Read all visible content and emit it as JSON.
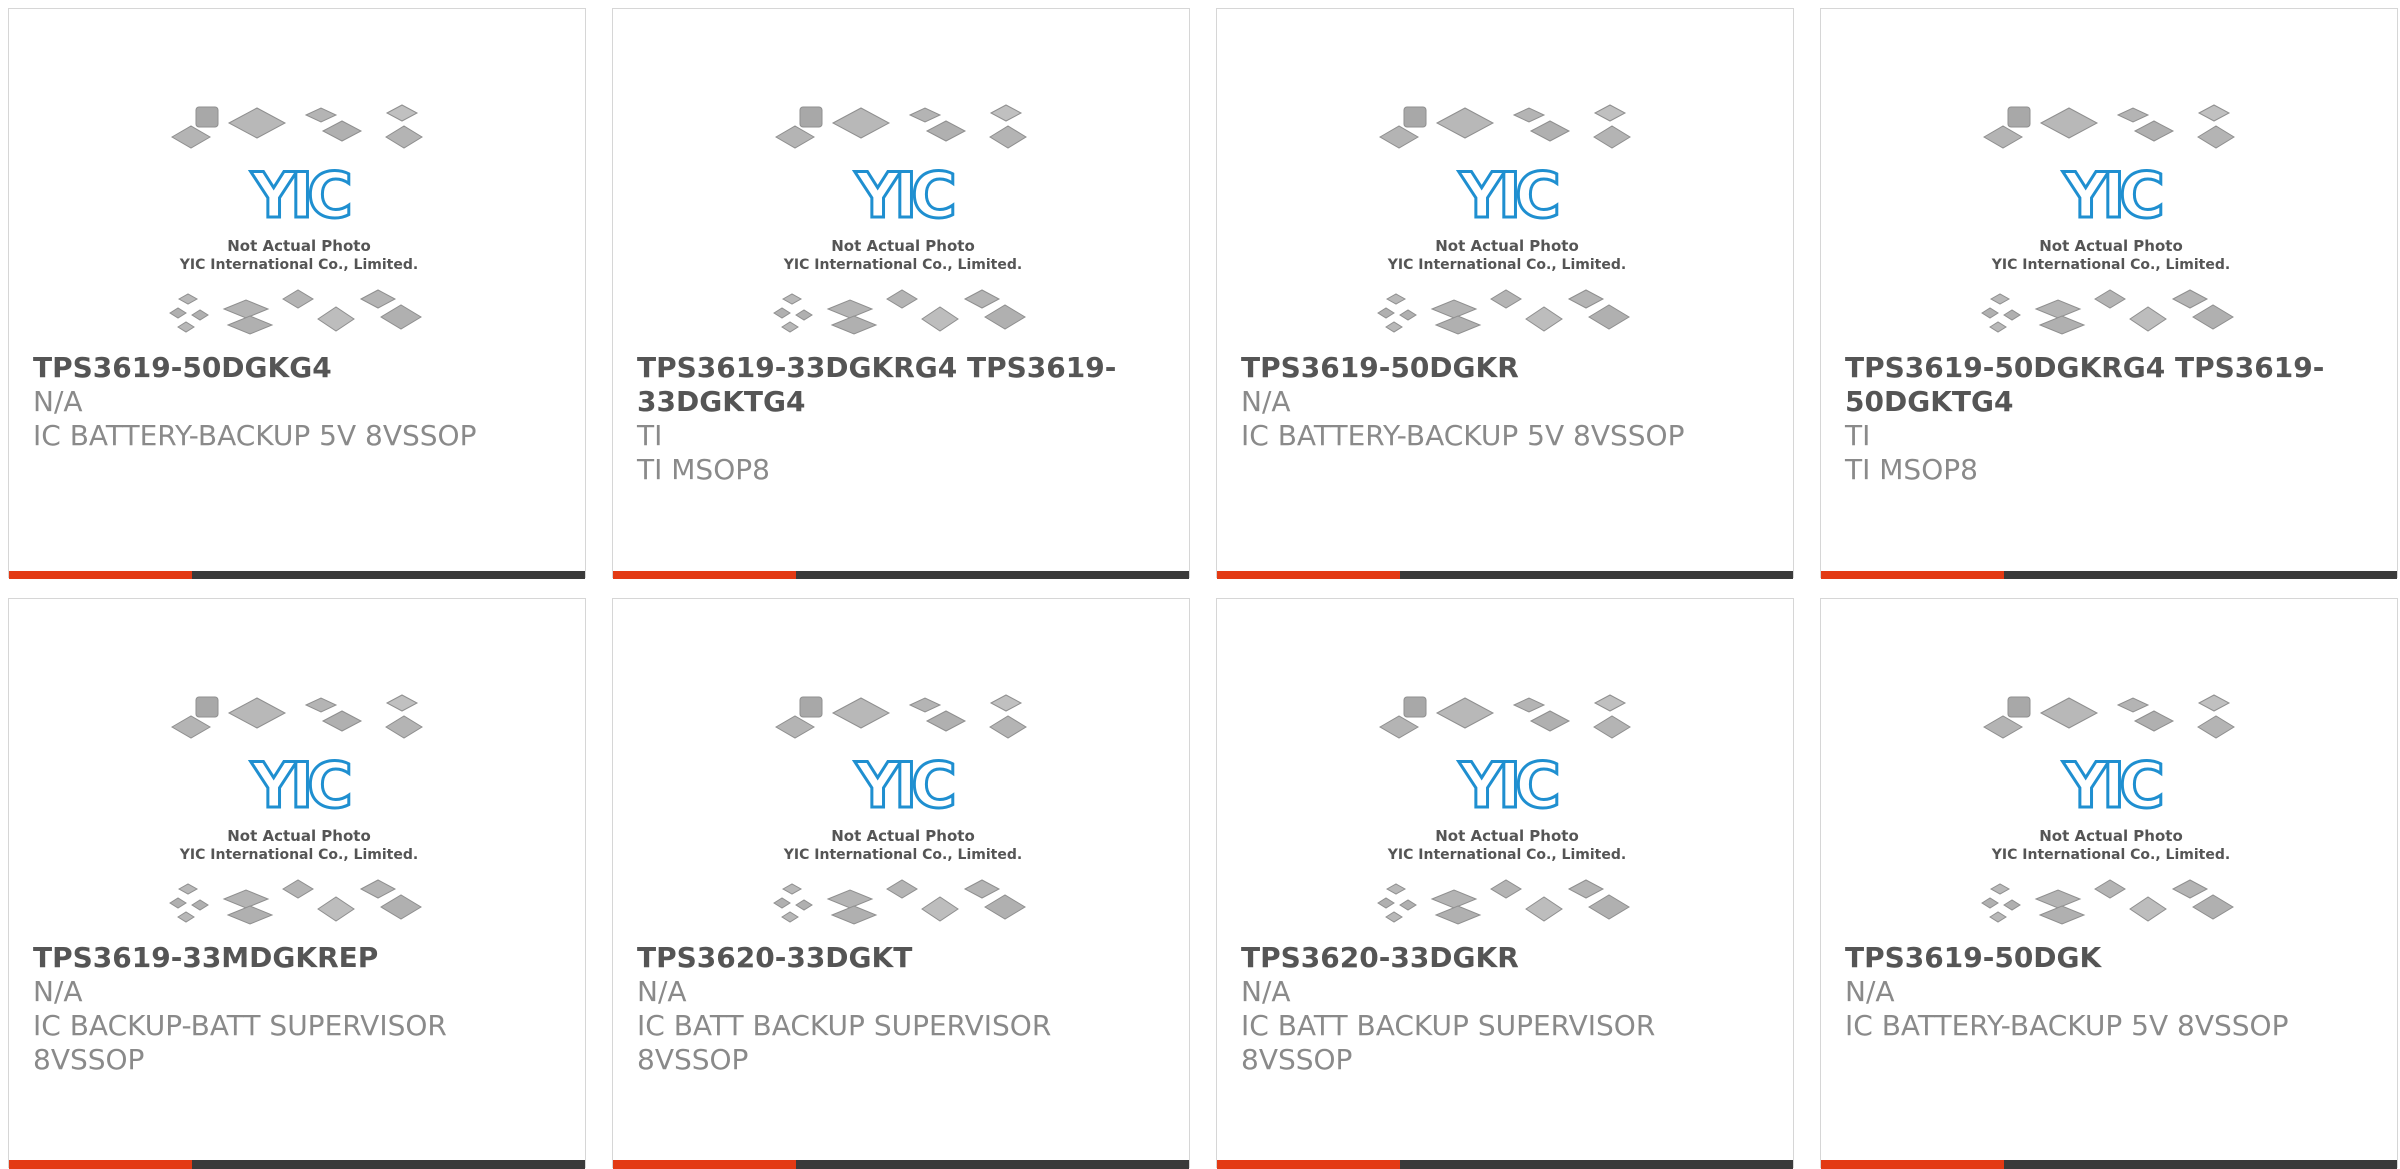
{
  "colors": {
    "accent": "#e33a14",
    "bar": "#3a3a3a",
    "title": "#555555",
    "text": "#8a8a8a",
    "logo": "#1f8fd0"
  },
  "placeholder": {
    "logo": "YIC",
    "line1": "Not Actual Photo",
    "line2": "YIC International Co., Limited."
  },
  "products": [
    {
      "pn": "TPS3619-50DGKG4",
      "mfr": "N/A",
      "desc": "IC BATTERY-BACKUP 5V 8VSSOP"
    },
    {
      "pn": "TPS3619-33DGKRG4 TPS3619-33DGKTG4",
      "mfr": "TI",
      "desc": "TI MSOP8"
    },
    {
      "pn": "TPS3619-50DGKR",
      "mfr": "N/A",
      "desc": "IC BATTERY-BACKUP 5V 8VSSOP"
    },
    {
      "pn": "TPS3619-50DGKRG4 TPS3619-50DGKTG4",
      "mfr": "TI",
      "desc": "TI MSOP8"
    },
    {
      "pn": "TPS3619-33MDGKREP",
      "mfr": "N/A",
      "desc": "IC BACKUP-BATT SUPERVISOR 8VSSOP"
    },
    {
      "pn": "TPS3620-33DGKT",
      "mfr": "N/A",
      "desc": "IC BATT BACKUP SUPERVISOR 8VSSOP"
    },
    {
      "pn": "TPS3620-33DGKR",
      "mfr": "N/A",
      "desc": "IC BATT BACKUP SUPERVISOR 8VSSOP"
    },
    {
      "pn": "TPS3619-50DGK",
      "mfr": "N/A",
      "desc": "IC BATTERY-BACKUP 5V 8VSSOP"
    }
  ]
}
